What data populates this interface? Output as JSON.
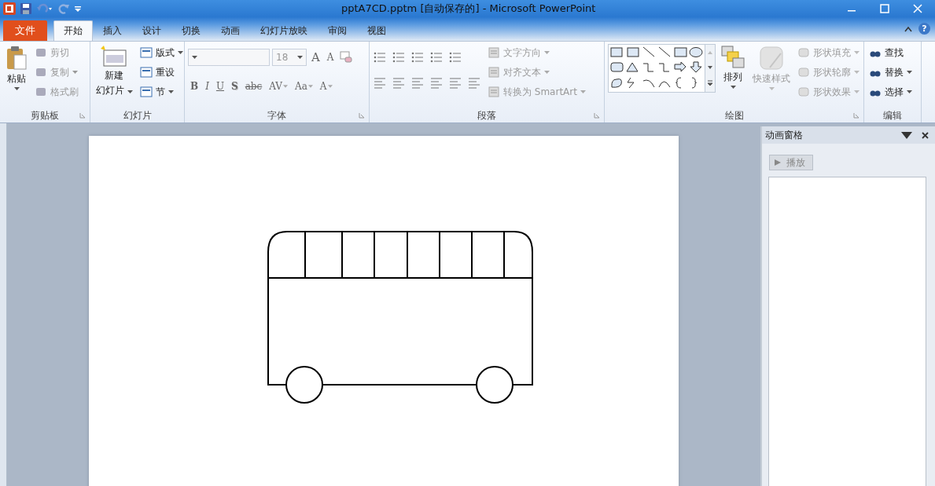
{
  "window": {
    "title": "pptA7CD.pptm [自动保存的] - Microsoft PowerPoint"
  },
  "tabs": [
    {
      "label": "文件",
      "kind": "file",
      "selected": false
    },
    {
      "label": "开始",
      "kind": "tab",
      "selected": true
    },
    {
      "label": "插入",
      "kind": "tab",
      "selected": false
    },
    {
      "label": "设计",
      "kind": "tab",
      "selected": false
    },
    {
      "label": "切换",
      "kind": "tab",
      "selected": false
    },
    {
      "label": "动画",
      "kind": "tab",
      "selected": false
    },
    {
      "label": "幻灯片放映",
      "kind": "tab",
      "selected": false
    },
    {
      "label": "审阅",
      "kind": "tab",
      "selected": false
    },
    {
      "label": "视图",
      "kind": "tab",
      "selected": false
    }
  ],
  "help": "?",
  "clipboard": {
    "label": "剪贴板",
    "paste": "粘贴",
    "items": [
      {
        "label": "剪切",
        "disabled": true,
        "dropdown": false
      },
      {
        "label": "复制",
        "disabled": true,
        "dropdown": true
      },
      {
        "label": "格式刷",
        "disabled": true,
        "dropdown": false
      }
    ]
  },
  "slides": {
    "label": "幻灯片",
    "new_slide": [
      "新建",
      "幻灯片"
    ],
    "items": [
      {
        "label": "版式",
        "disabled": false,
        "dropdown": true
      },
      {
        "label": "重设",
        "disabled": false,
        "dropdown": false
      },
      {
        "label": "节",
        "disabled": false,
        "dropdown": true
      }
    ]
  },
  "font": {
    "label": "字体",
    "font_size": "18",
    "size_buttons": [
      "A",
      "A"
    ],
    "formats": [
      {
        "label": "B",
        "dropdown": false
      },
      {
        "label": "I",
        "dropdown": false
      },
      {
        "label": "U",
        "dropdown": false
      },
      {
        "label": "S",
        "dropdown": false
      },
      {
        "label": "abc",
        "dropdown": false
      },
      {
        "label": "AV",
        "dropdown": true
      },
      {
        "label": "Aa",
        "dropdown": true
      },
      {
        "label": "A",
        "dropdown": true
      }
    ]
  },
  "paragraph": {
    "label": "段落",
    "items": [
      {
        "label": "文字方向",
        "disabled": true,
        "dropdown": true
      },
      {
        "label": "对齐文本",
        "disabled": true,
        "dropdown": true
      },
      {
        "label": "转换为 SmartArt",
        "disabled": true,
        "dropdown": true
      }
    ]
  },
  "drawing": {
    "label": "绘图",
    "arrange": "排列",
    "quick_styles": "快速样式",
    "quick_styles_disabled": true,
    "items": [
      {
        "label": "形状填充",
        "disabled": true,
        "dropdown": true
      },
      {
        "label": "形状轮廓",
        "disabled": true,
        "dropdown": true
      },
      {
        "label": "形状效果",
        "disabled": true,
        "dropdown": true
      }
    ]
  },
  "editing": {
    "label": "编辑",
    "items": [
      {
        "label": "查找",
        "disabled": false,
        "dropdown": false
      },
      {
        "label": "替换",
        "disabled": false,
        "dropdown": true
      },
      {
        "label": "选择",
        "disabled": false,
        "dropdown": true
      }
    ]
  },
  "animation_pane": {
    "title": "动画窗格",
    "play": "播放",
    "play_disabled": true
  }
}
